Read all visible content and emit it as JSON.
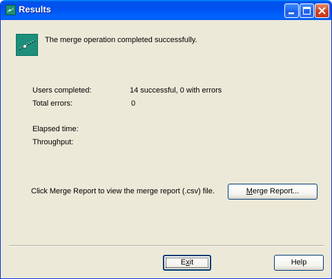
{
  "window": {
    "title": "Results"
  },
  "message": {
    "text": "The merge operation completed successfully.",
    "icon": "merge-success-icon"
  },
  "stats": {
    "users_completed_label": "Users completed:",
    "users_completed_value": "14 successful, 0 with errors",
    "total_errors_label": "Total errors:",
    "total_errors_value": "0",
    "elapsed_time_label": "Elapsed time:",
    "throughput_label": "Throughput:"
  },
  "report": {
    "instruction": "Click Merge Report to view the merge report (.csv) file.",
    "button_mnemonic": "M",
    "button_rest": "erge Report..."
  },
  "footer": {
    "exit_mnemonic": "x",
    "exit_prefix": "E",
    "exit_suffix": "it",
    "help_label": "Help"
  },
  "colors": {
    "titlebar": "#0054e3",
    "close_button": "#d0411d",
    "dialog_face": "#ece9d8",
    "icon_teal": "#1d8f7a"
  }
}
